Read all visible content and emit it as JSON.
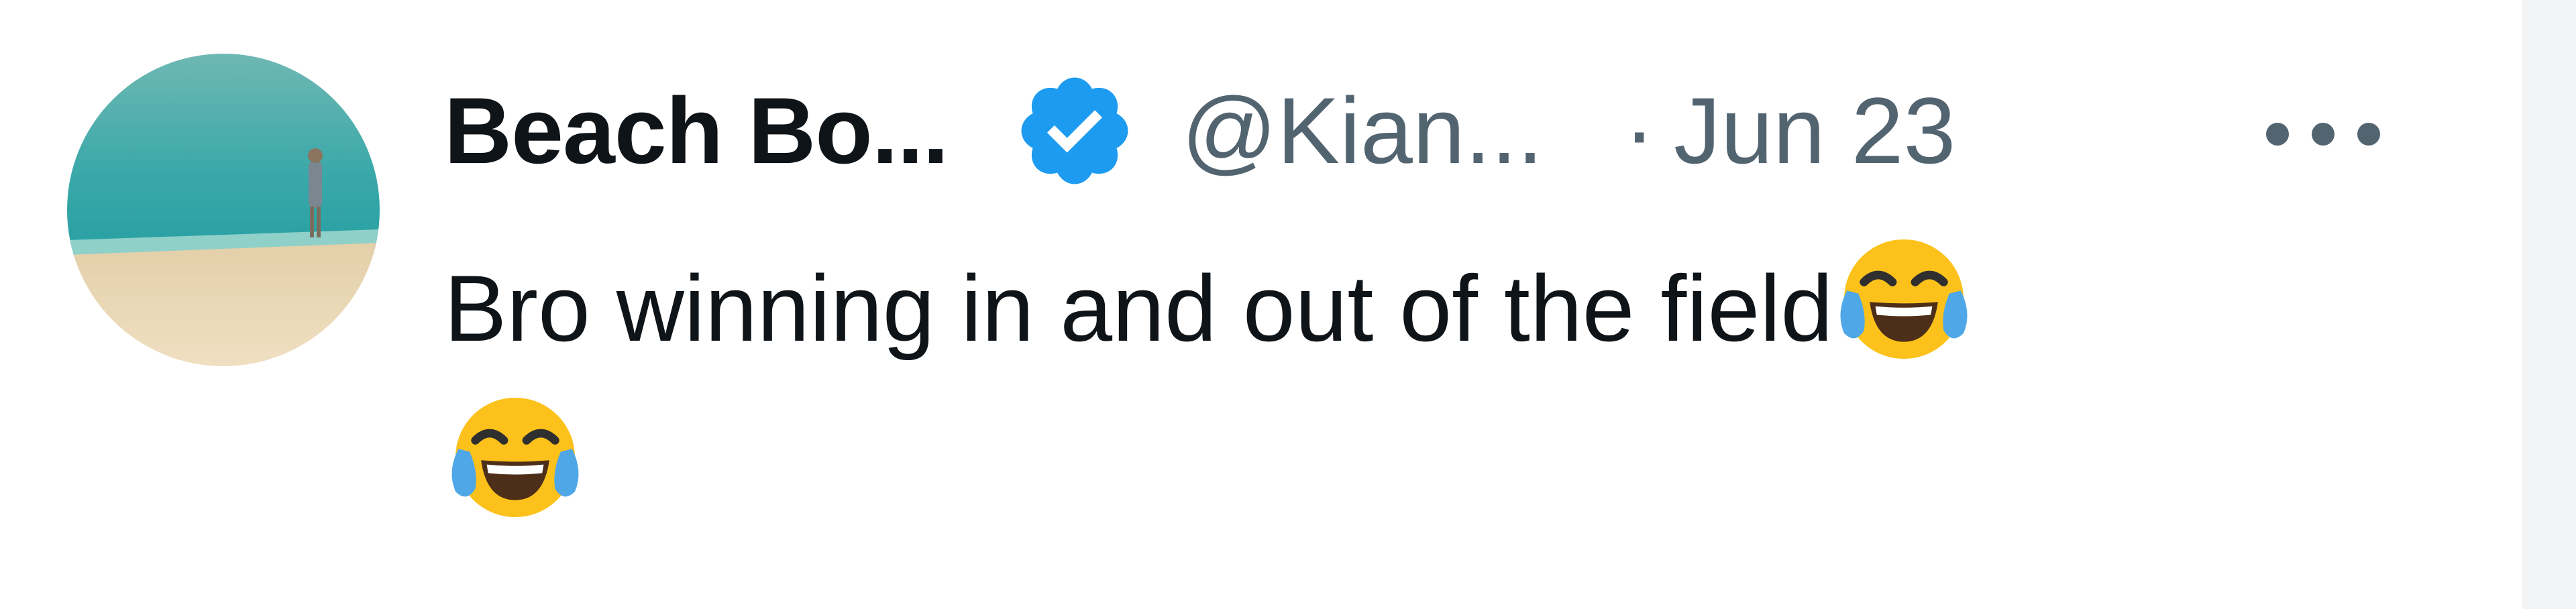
{
  "tweet": {
    "display_name": "Beach Bo...",
    "verified_icon": "verified-badge-icon",
    "handle": "@Kian...",
    "separator": "·",
    "date": "Jun 23",
    "more_icon": "more-options-icon",
    "text": "Bro winning in and out of the field",
    "emoji_icon": "face-with-tears-of-joy-icon",
    "emoji_count": 2
  },
  "colors": {
    "text_primary": "#0f1419",
    "text_secondary": "#536471",
    "verified_blue": "#1d9bf0",
    "side_strip": "#f2f3f4"
  }
}
